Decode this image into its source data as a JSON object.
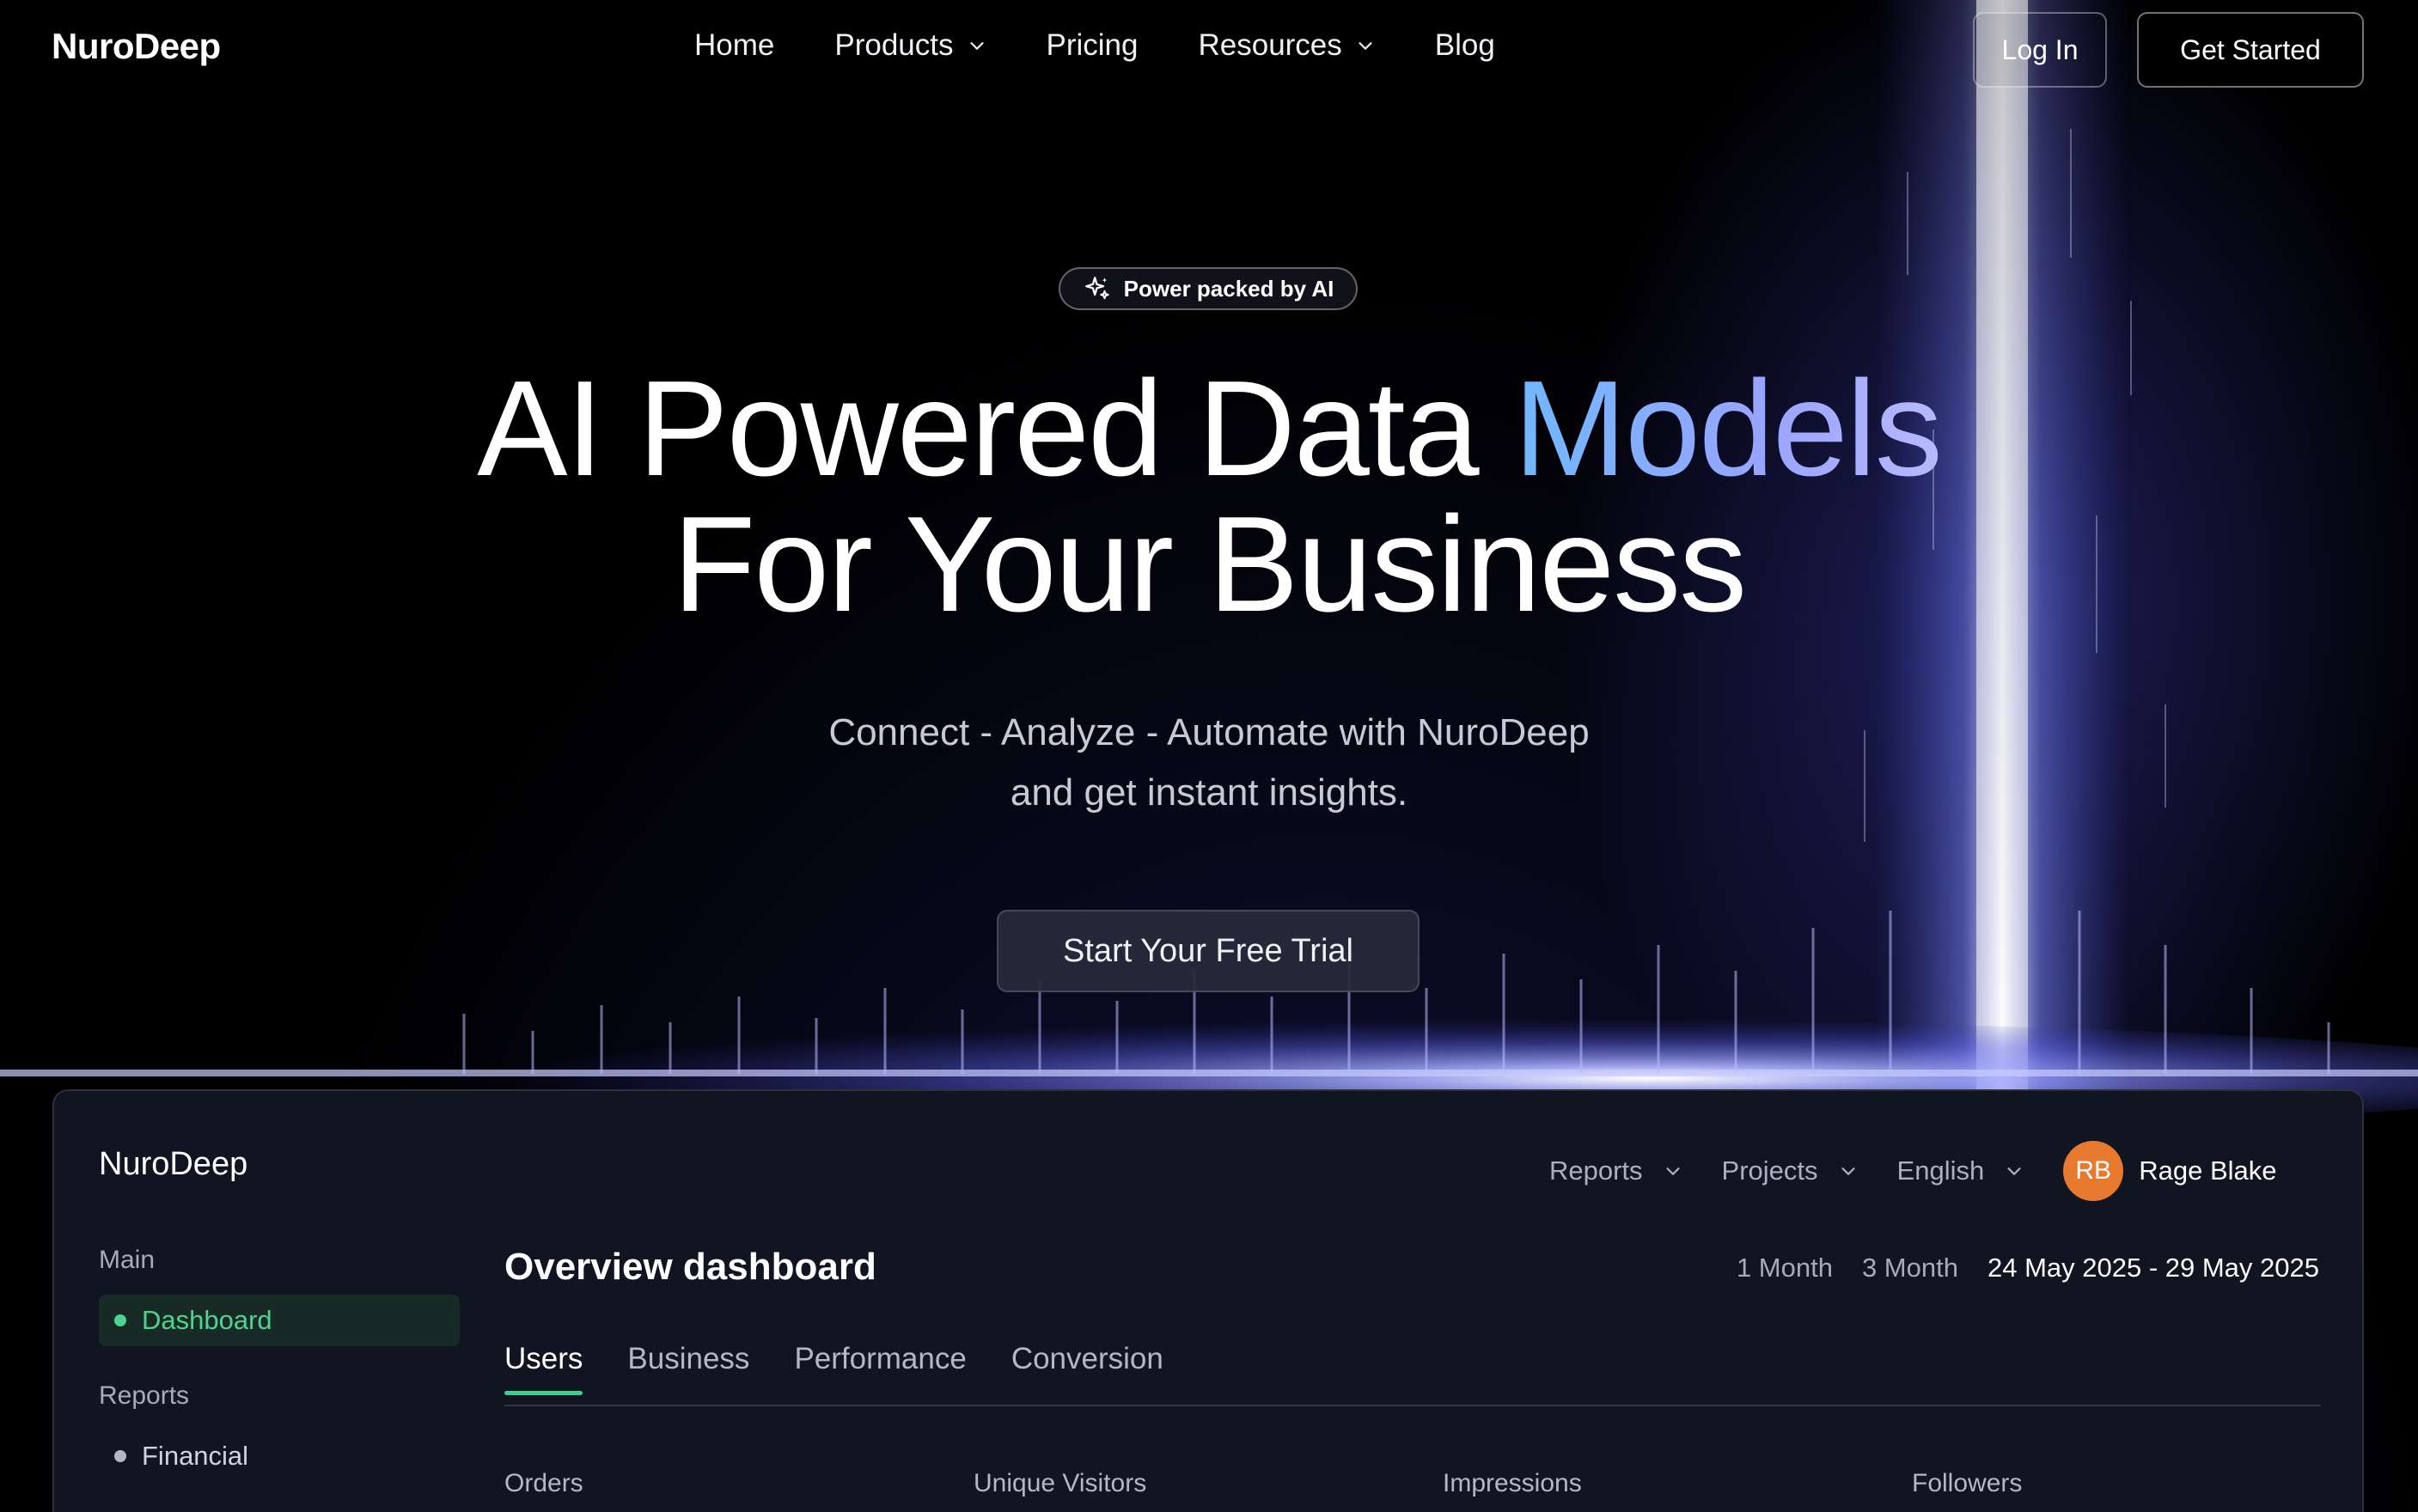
{
  "nav": {
    "logo": "NuroDeep",
    "links": [
      {
        "label": "Home",
        "dropdown": false
      },
      {
        "label": "Products",
        "dropdown": true
      },
      {
        "label": "Pricing",
        "dropdown": false
      },
      {
        "label": "Resources",
        "dropdown": true
      },
      {
        "label": "Blog",
        "dropdown": false
      }
    ],
    "login_label": "Log In",
    "cta_label": "Get Started"
  },
  "hero": {
    "badge": "Power packed by AI",
    "title_line1_plain": "AI Powered Data ",
    "title_line1_accent": "Models",
    "title_line2": "For Your Business",
    "subtitle_line1": "Connect - Analyze - Automate with NuroDeep",
    "subtitle_line2": "and get instant insights.",
    "cta": "Start Your Free Trial"
  },
  "dashboard": {
    "logo": "NuroDeep",
    "menus": [
      "Reports",
      "Projects",
      "English"
    ],
    "user": {
      "initials": "RB",
      "name": "Rage Blake"
    },
    "sidebar": {
      "main_heading": "Main",
      "main_items": [
        "Dashboard"
      ],
      "reports_heading": "Reports",
      "reports_items": [
        "Financial"
      ]
    },
    "title": "Overview dashboard",
    "ranges": [
      "1 Month",
      "3 Month"
    ],
    "date_range": "24 May 2025 - 29 May 2025",
    "tabs": [
      "Users",
      "Business",
      "Performance",
      "Conversion"
    ],
    "metrics": [
      "Orders",
      "Unique Visitors",
      "Impressions",
      "Followers"
    ]
  },
  "colors": {
    "accent_blue": "#6fb8ff",
    "accent_violet": "#b8b9ff",
    "active_green": "#3ccf8e",
    "avatar_orange": "#e87a2f"
  }
}
